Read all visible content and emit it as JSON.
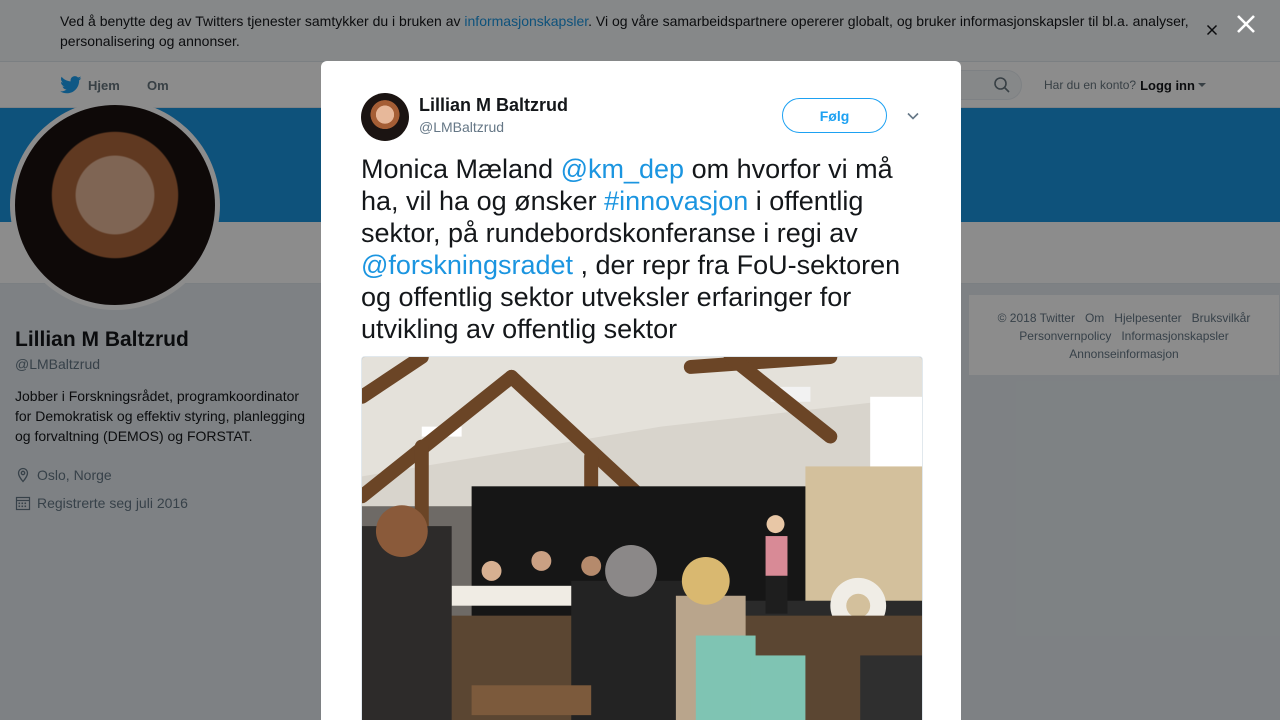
{
  "cookie_bar": {
    "text_before": "Ved å benytte deg av Twitters tjenester samtykker du i bruken av ",
    "link": "informasjonskapsler",
    "text_after": ". Vi og våre samarbeidspartnere opererer globalt, og bruker informasjonskapsler til bl.a. analyser, personalisering og annonser."
  },
  "nav": {
    "home": "Hjem",
    "about": "Om",
    "account_prompt": "Har du en konto?",
    "login": "Logg inn"
  },
  "profile": {
    "name": "Lillian M Baltzrud",
    "handle": "@LMBaltzrud",
    "bio": "Jobber i Forskningsrådet, programkoordinator for Demokratisk og effektiv styring, planlegging og forvaltning (DEMOS) og FORSTAT.",
    "location": "Oslo, Norge",
    "joined": "Registrerte seg juli 2016"
  },
  "footer": {
    "links": [
      "© 2018 Twitter",
      "Om",
      "Hjelpesenter",
      "Bruksvilkår",
      "Personvernpolicy",
      "Informasjonskapsler",
      "Annonseinformasjon"
    ]
  },
  "tweet": {
    "author_name": "Lillian M Baltzrud",
    "author_handle": "@LMBaltzrud",
    "follow_label": "Følg",
    "text_1": "Monica Mæland ",
    "mention_1": "@km_dep",
    "text_2": " om hvorfor vi må ha, vil ha og ønsker ",
    "hashtag": "#innovasjon",
    "text_3": " i offentlig sektor, på rundebordskonferanse i regi av ",
    "mention_2": "@forskningsradet",
    "text_4": " , der repr fra FoU-sektoren og offentlig sektor utveksler erfaringer for utvikling av offentlig sektor"
  },
  "colors": {
    "accent": "#1da1f2",
    "banner": "#1b95e0",
    "link": "#1b95e0"
  }
}
